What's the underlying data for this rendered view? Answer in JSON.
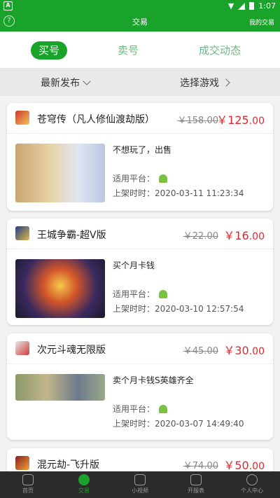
{
  "status_bar": {
    "time": "1:07",
    "app_badge": "A"
  },
  "app_bar": {
    "title": "交易",
    "right_link": "我的交易",
    "help_icon": "?"
  },
  "tabs": [
    {
      "label": "买号",
      "active": true
    },
    {
      "label": "卖号",
      "active": false
    },
    {
      "label": "成交动态",
      "active": false
    }
  ],
  "filters": {
    "latest": "最新发布",
    "select_game": "选择游戏"
  },
  "listings": [
    {
      "game": "苍穹传（凡人修仙渡劫版）",
      "old_price": "￥158.00",
      "price_int": "￥125",
      "price_dec": ".00",
      "desc": "不想玩了，出售",
      "platform_label": "适用平台：",
      "time": "上架时时：2020-03-11 11:23:34"
    },
    {
      "game": "王城争霸-超V版",
      "old_price": "￥22.00",
      "price_int": "￥16",
      "price_dec": ".00",
      "desc": "买个月卡钱",
      "platform_label": "适用平台：",
      "time": "上架时时：2020-03-10 12:57:54"
    },
    {
      "game": "次元斗魂无限版",
      "old_price": "￥45.00",
      "price_int": "￥30",
      "price_dec": ".00",
      "desc": "卖个月卡钱S英雄齐全",
      "platform_label": "适用平台：",
      "time": "上架时时：2020-03-07 14:49:40"
    },
    {
      "game": "混元劫-飞升版",
      "old_price": "￥74.00",
      "price_int": "￥50",
      "price_dec": ".00"
    }
  ],
  "bottom_nav": [
    {
      "label": "首页",
      "icon": "gamepad-icon",
      "active": false
    },
    {
      "label": "交易",
      "icon": "trade-icon",
      "active": true
    },
    {
      "label": "小视频",
      "icon": "video-icon",
      "active": false
    },
    {
      "label": "开服表",
      "icon": "server-icon",
      "active": false
    },
    {
      "label": "个人中心",
      "icon": "person-icon",
      "active": false
    }
  ],
  "colors": {
    "brand_green": "#1aa32a",
    "price_red": "#e0262c"
  }
}
